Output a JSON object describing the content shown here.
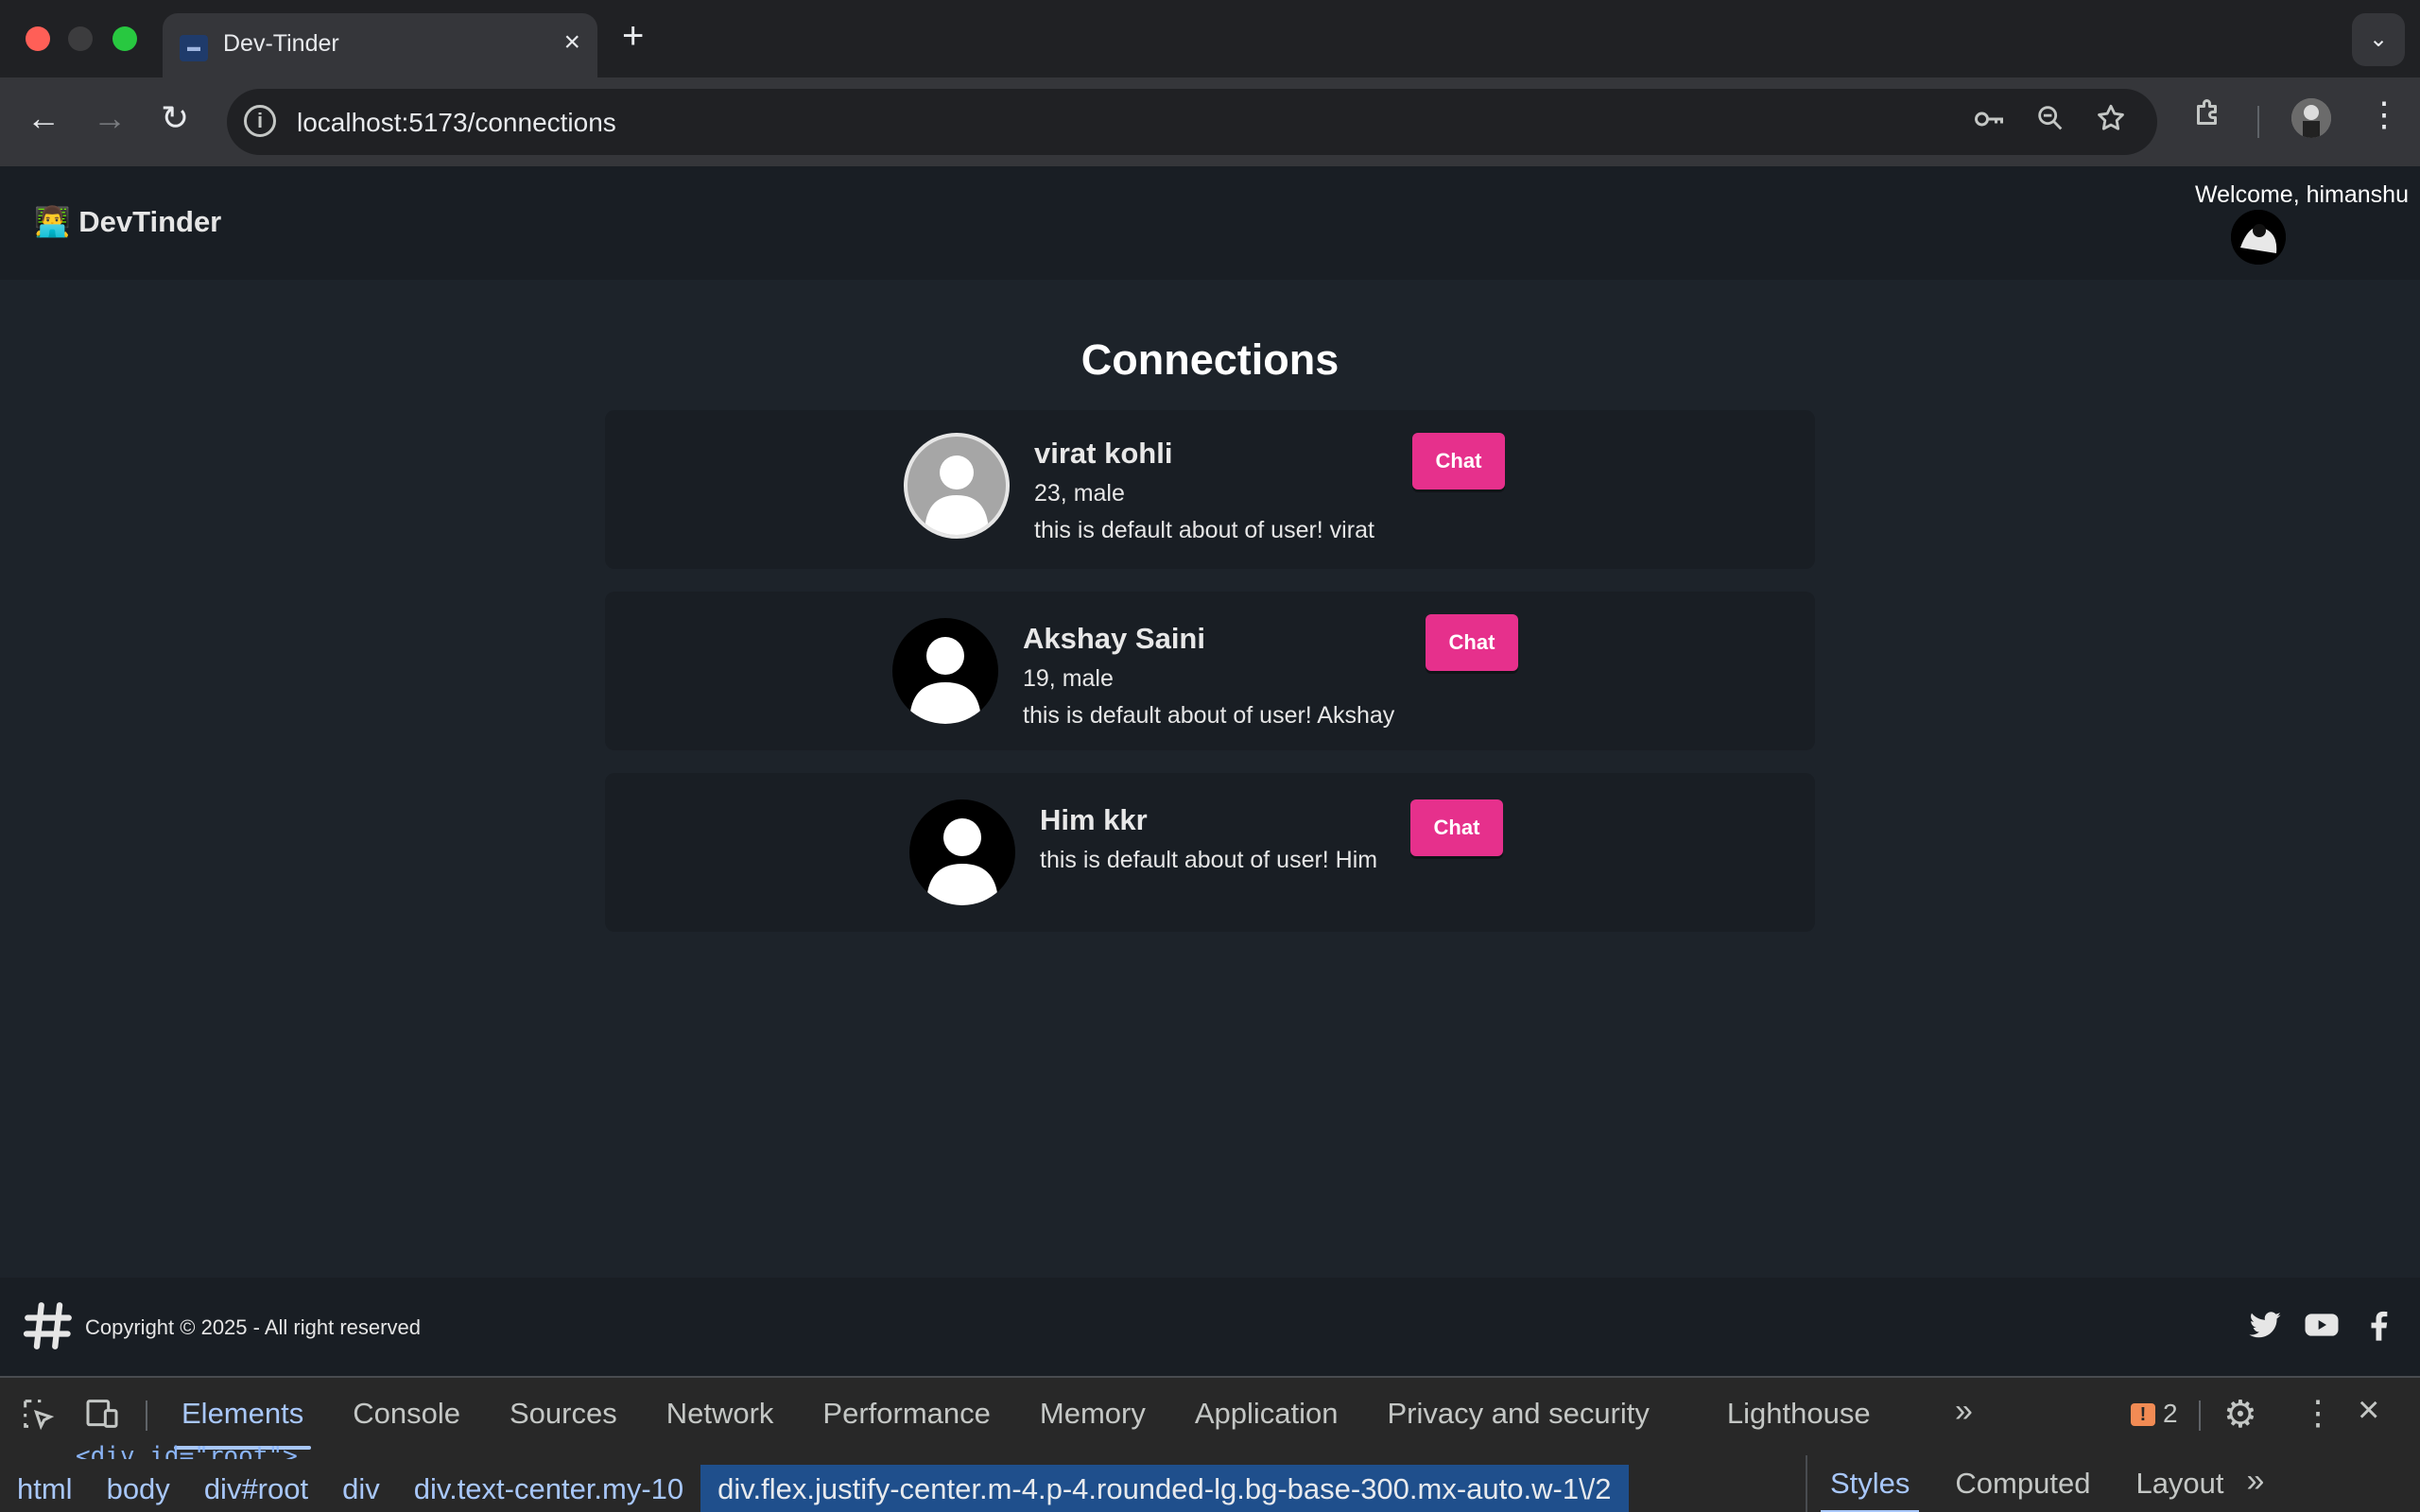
{
  "browser": {
    "tab_title": "Dev-Tinder",
    "url": "localhost:5173/connections"
  },
  "navbar": {
    "brand": "👨‍💻 DevTinder",
    "welcome": "Welcome, himanshu"
  },
  "main": {
    "title": "Connections",
    "connections": [
      {
        "name": "virat kohli",
        "meta": "23, male",
        "about": "this is default about of user! virat",
        "chat_label": "Chat"
      },
      {
        "name": "Akshay Saini",
        "meta": "19, male",
        "about": "this is default about of user! Akshay",
        "chat_label": "Chat"
      },
      {
        "name": "Him kkr",
        "meta": "",
        "about": "this is default about of user! Him",
        "chat_label": "Chat"
      }
    ]
  },
  "footer": {
    "copyright": "Copyright © 2025 - All right reserved"
  },
  "devtools": {
    "tabs": [
      "Elements",
      "Console",
      "Sources",
      "Network",
      "Performance",
      "Memory",
      "Application",
      "Privacy and security",
      "Lighthouse"
    ],
    "issues_count": "2",
    "code_line": "<div id=\"root\">",
    "breadcrumbs": [
      "html",
      "body",
      "div#root",
      "div",
      "div.text-center.my-10",
      "div.flex.justify-center.m-4.p-4.rounded-lg.bg-base-300.mx-auto.w-1\\/2"
    ],
    "styles_tabs": [
      "Styles",
      "Computed",
      "Layout"
    ]
  },
  "colors": {
    "accent": "#e6308c",
    "page_bg": "#1d232a",
    "card_bg": "#191e24"
  }
}
